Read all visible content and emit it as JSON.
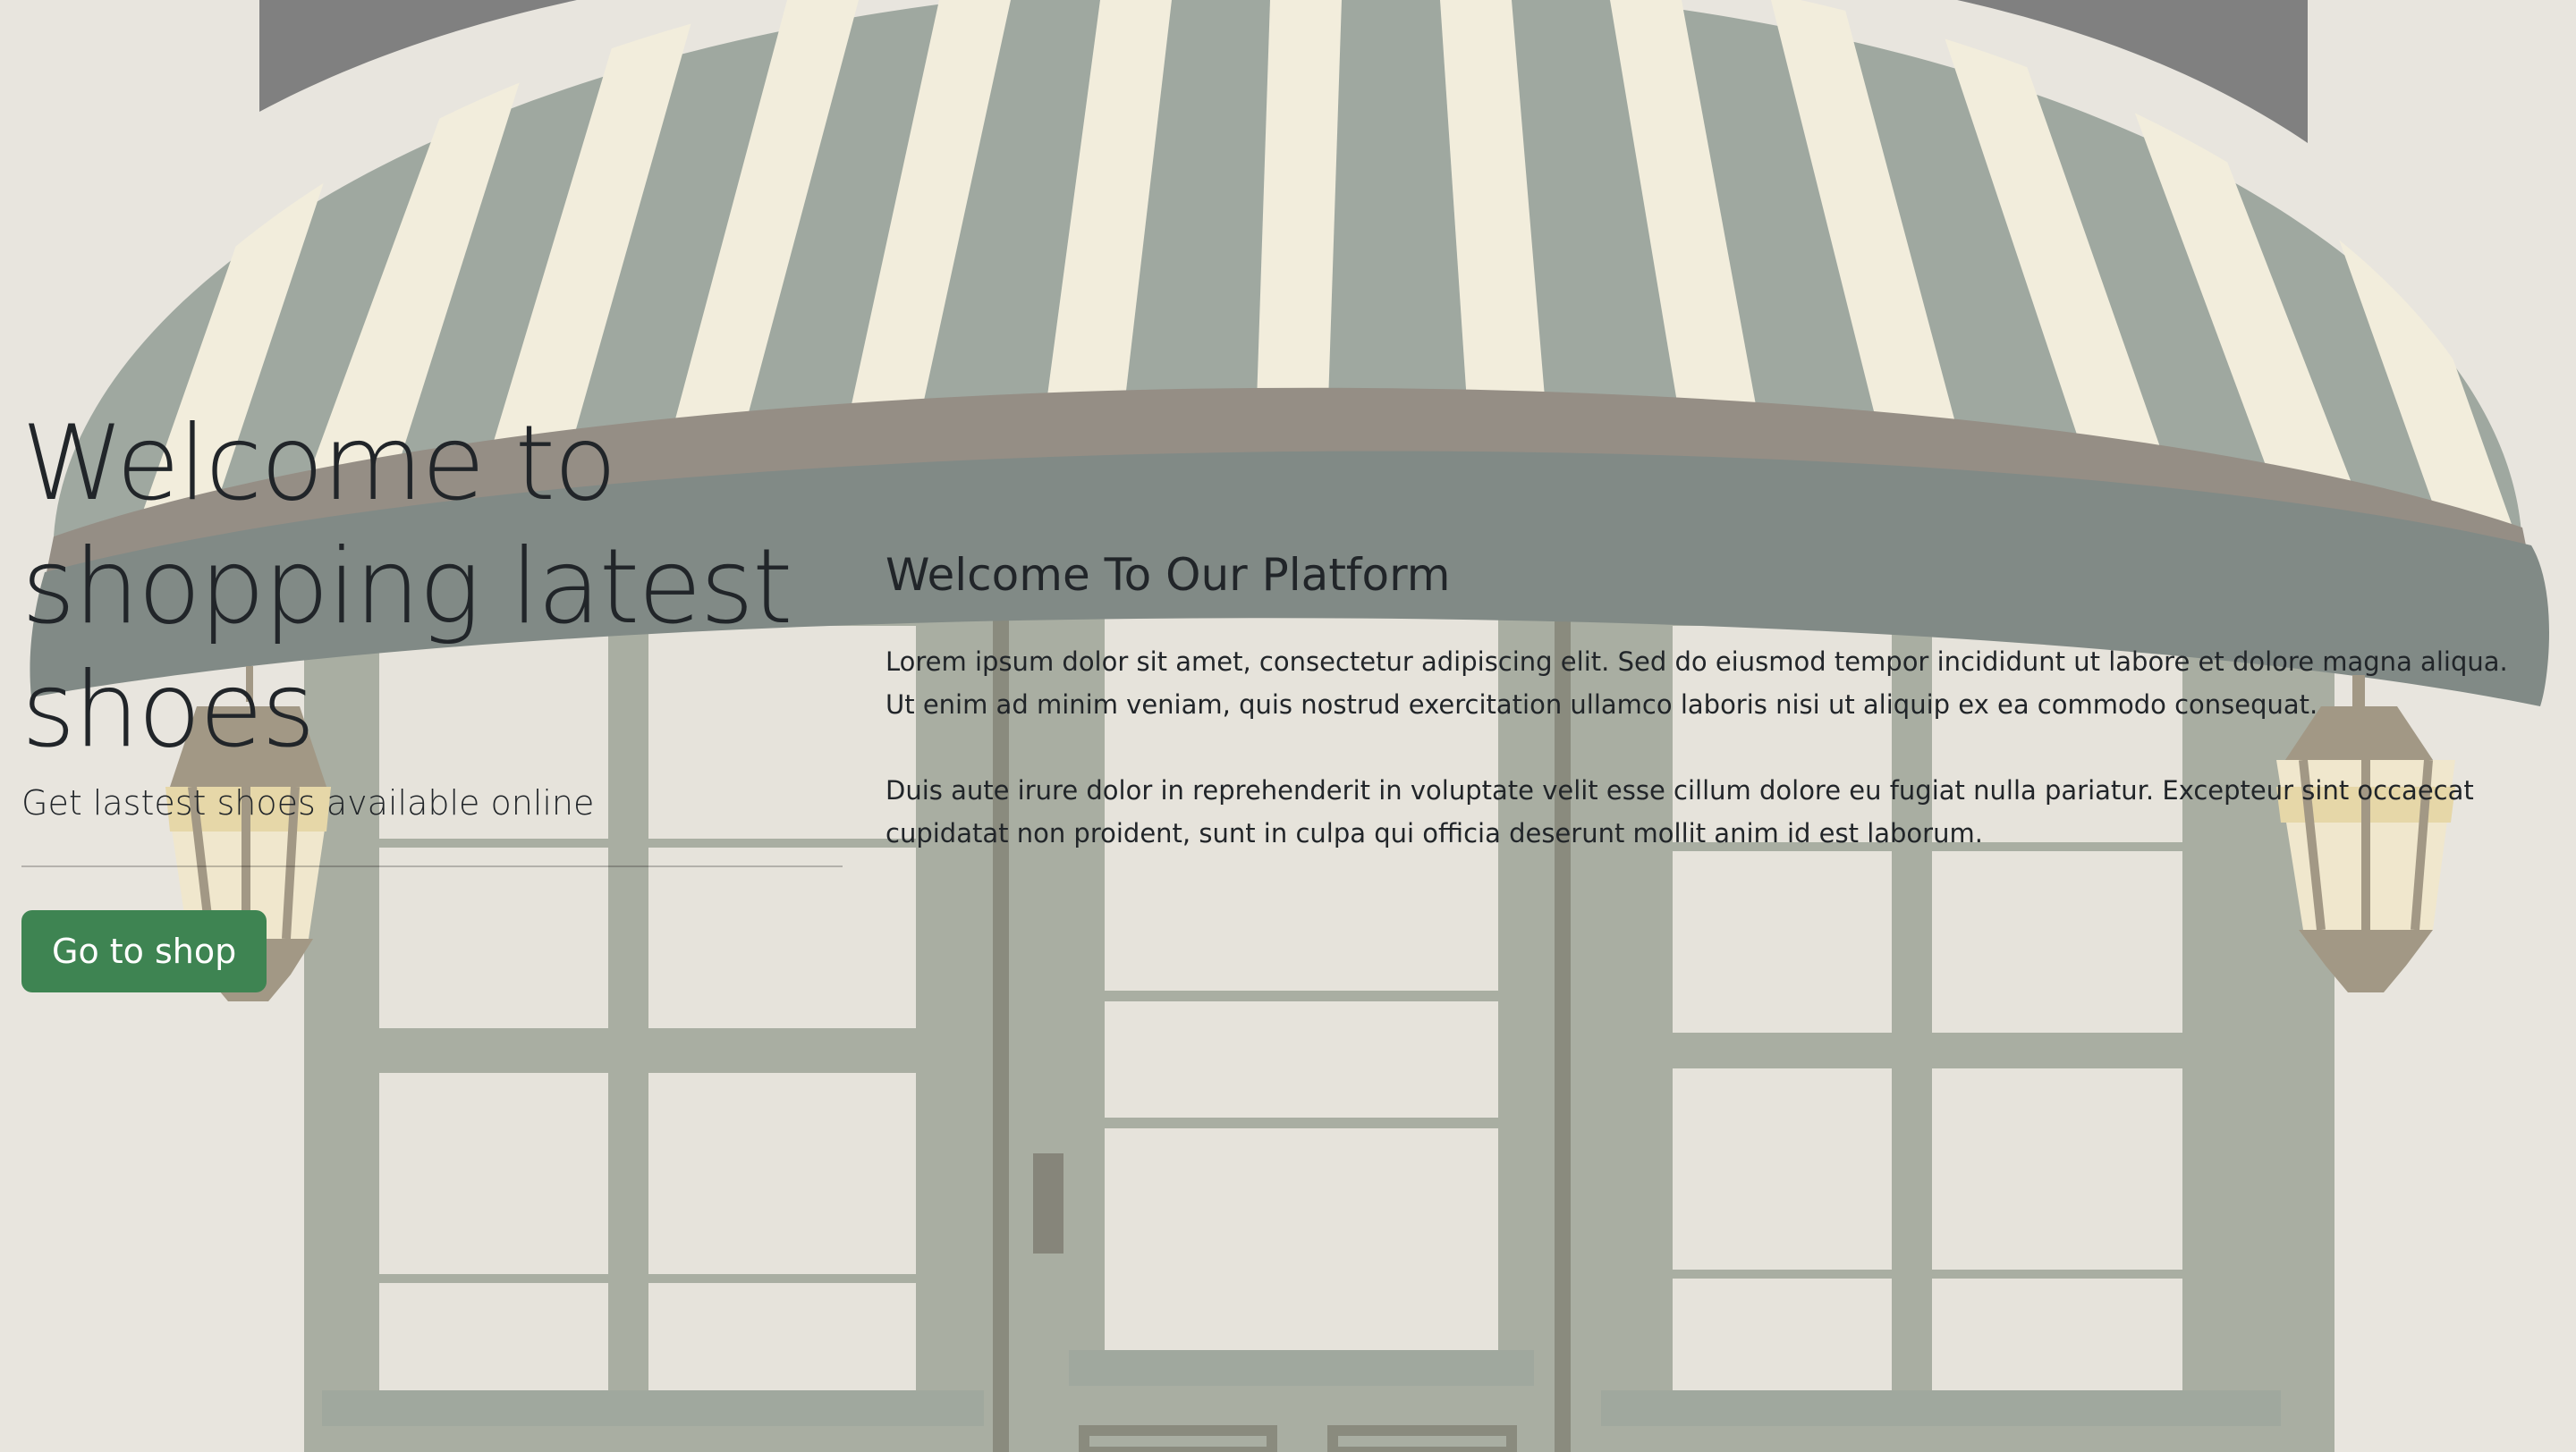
{
  "hero": {
    "title": "Welcome to shopping latest shoes",
    "lead": "Get lastest shoes available online",
    "button_label": "Go to shop"
  },
  "content": {
    "heading": "Welcome To Our Platform",
    "paragraphs": [
      "Lorem ipsum dolor sit amet, consectetur adipiscing elit. Sed do eiusmod tempor incididunt ut labore et dolore magna aliqua. Ut enim ad minim veniam, quis nostrud exercitation ullamco laboris nisi ut aliquip ex ea commodo consequat.",
      "Duis aute irure dolor in reprehenderit in voluptate velit esse cillum dolore eu fugiat nulla pariatur. Excepteur sint occaecat cupidatat non proident, sunt in culpa qui officia deserunt mollit anim id est laborum."
    ]
  },
  "colors": {
    "background": "#e8e5de",
    "awning_stripe_green": "#9fa8a0",
    "awning_stripe_cream": "#f2eddc",
    "storefront_green": "#abb1a6",
    "button_green": "#3e8452",
    "text_dark": "#212529"
  },
  "icons": {
    "background": "storefront-illustration",
    "left_lamp": "lantern-icon",
    "right_lamp": "lantern-icon"
  }
}
